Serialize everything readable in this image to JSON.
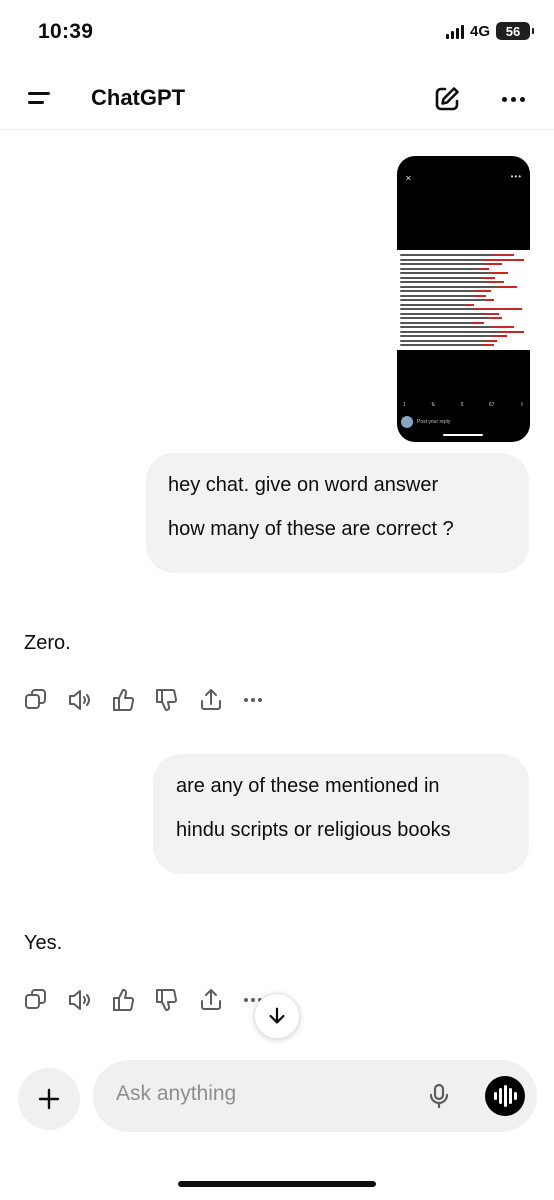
{
  "status": {
    "time": "10:39",
    "network": "4G",
    "battery": "56"
  },
  "header": {
    "title": "ChatGPT",
    "menu_icon": "menu-icon",
    "new_chat_icon": "edit-icon",
    "more_icon": "more-icon"
  },
  "messages": [
    {
      "role": "user",
      "has_image": true,
      "lines": [
        "hey chat.  give on word answer",
        "how many of these are correct ?"
      ]
    },
    {
      "role": "assistant",
      "text": "Zero."
    },
    {
      "role": "user",
      "lines": [
        "are any of these mentioned in",
        "hindu scripts or religious books"
      ]
    },
    {
      "role": "assistant",
      "text": "Yes."
    }
  ],
  "attachment": {
    "reply_placeholder": "Post your reply",
    "stats": [
      "1",
      "5",
      "67"
    ]
  },
  "message_actions": [
    "copy-icon",
    "speaker-icon",
    "thumbs-up-icon",
    "thumbs-down-icon",
    "share-icon",
    "more-icon"
  ],
  "composer": {
    "placeholder": "Ask anything",
    "plus_icon": "plus-icon",
    "mic_icon": "mic-icon",
    "voice_icon": "voice-mode-icon"
  },
  "colors": {
    "bubble": "#f2f2f2",
    "text": "#0d0d0d",
    "placeholder": "#8e8e8e",
    "voice_button": "#000000"
  }
}
